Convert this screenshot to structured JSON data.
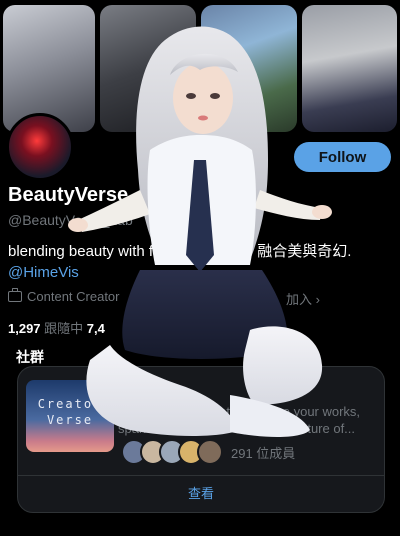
{
  "header_photos": [
    "photo 1",
    "photo 2",
    "photo 3",
    "photo 4"
  ],
  "profile": {
    "display_name": "BeautyVerse",
    "handle": "@BeautyVerse_Lab",
    "bio_text": "blending beauty with f... 幻想の融合 / 融合美與奇幻. ",
    "bio_mention": "@HimeVis",
    "category": "Content Creator",
    "joined": "加入 ›",
    "following_count": "1,297",
    "following_label": " 跟隨中  ",
    "followers_count": "7,4",
    "follow_button": "Follow"
  },
  "community": {
    "section_title": "社群",
    "thumb_title": "Creator Verse",
    "description": "A universe for creators. Share your works, spark ideas, and co-create the future of...",
    "member_count": "291 位成員",
    "view_label": "查看"
  },
  "colors": {
    "accent": "#5aa2e6",
    "background": "#000000",
    "card": "#16181c",
    "muted": "#71767b"
  }
}
